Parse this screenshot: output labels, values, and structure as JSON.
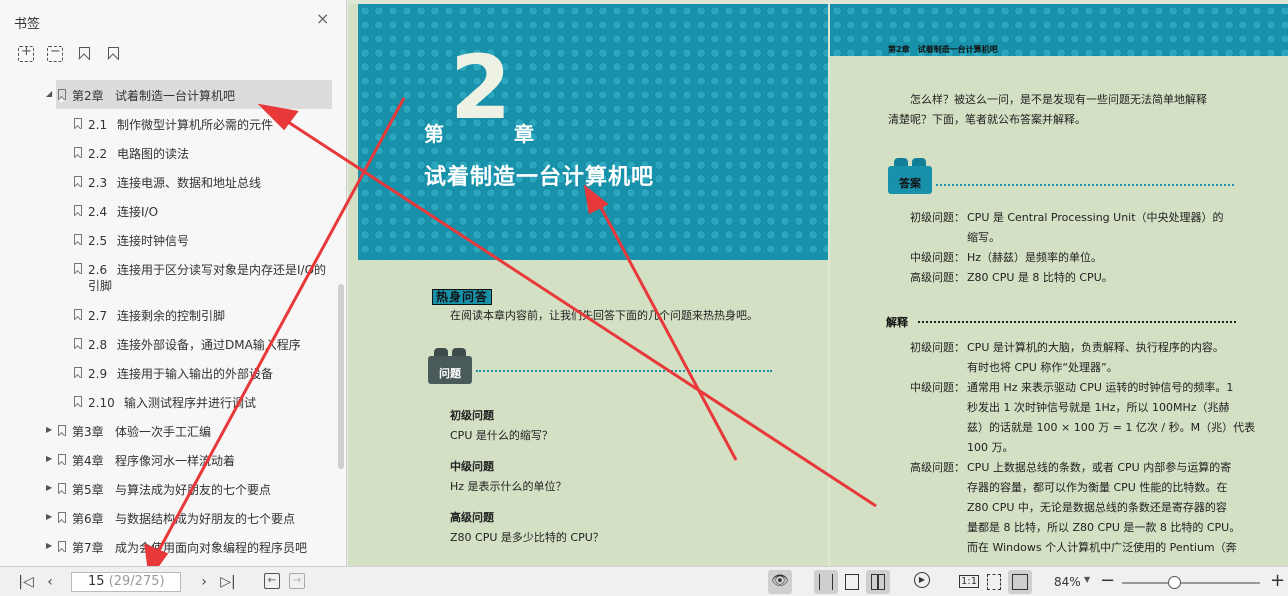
{
  "sidebar": {
    "title": "书签",
    "close": "×",
    "toc": [
      {
        "num": "第2章",
        "title": "试着制造一台计算机吧",
        "level": 0,
        "expanded": true,
        "selected": true
      },
      {
        "num": "2.1",
        "title": "制作微型计算机所必需的元件",
        "level": 1
      },
      {
        "num": "2.2",
        "title": "电路图的读法",
        "level": 1
      },
      {
        "num": "2.3",
        "title": "连接电源、数据和地址总线",
        "level": 1
      },
      {
        "num": "2.4",
        "title": "连接I/O",
        "level": 1
      },
      {
        "num": "2.5",
        "title": "连接时钟信号",
        "level": 1
      },
      {
        "num": "2.6",
        "title": "连接用于区分读写对象是内存还是I/O的引脚",
        "level": 1,
        "wrap": true
      },
      {
        "num": "2.7",
        "title": "连接剩余的控制引脚",
        "level": 1
      },
      {
        "num": "2.8",
        "title": "连接外部设备，通过DMA输入程序",
        "level": 1
      },
      {
        "num": "2.9",
        "title": "连接用于输入输出的外部设备",
        "level": 1
      },
      {
        "num": "2.10",
        "title": "输入测试程序并进行调试",
        "level": 1
      },
      {
        "num": "第3章",
        "title": "体验一次手工汇编",
        "level": 0
      },
      {
        "num": "第4章",
        "title": "程序像河水一样流动着",
        "level": 0
      },
      {
        "num": "第5章",
        "title": "与算法成为好朋友的七个要点",
        "level": 0
      },
      {
        "num": "第6章",
        "title": "与数据结构成为好朋友的七个要点",
        "level": 0
      },
      {
        "num": "第7章",
        "title": "成为会使用面向对象编程的程序员吧",
        "level": 0
      }
    ]
  },
  "left_page": {
    "chapter_prefix": "第",
    "chapter_number": "2",
    "chapter_suffix": "章",
    "chapter_title": "试着制造一台计算机吧",
    "warmup_label": "热身问答",
    "warmup_text": "在阅读本章内容前，让我们先回答下面的几个问题来热热身吧。",
    "question_label": "问题",
    "questions": [
      {
        "level": "初级问题",
        "text": "CPU 是什么的缩写？"
      },
      {
        "level": "中级问题",
        "text": "Hz 是表示什么的单位？"
      },
      {
        "level": "高级问题",
        "text": "Z80 CPU 是多少比特的 CPU？"
      }
    ]
  },
  "right_page": {
    "header": "第2章　试着制造一台计算机吧",
    "intro_line1": "怎么样？被这么一问，是不是发现有一些问题无法简单地解释",
    "intro_line2": "清楚呢？下面，笔者就公布答案并解释。",
    "answer_label": "答案",
    "answers": [
      {
        "level": "初级问题：",
        "line1": "CPU 是 Central Processing Unit（中央处理器）的",
        "line2": "缩写。"
      },
      {
        "level": "中级问题：",
        "line1": "Hz（赫兹）是频率的单位。"
      },
      {
        "level": "高级问题：",
        "line1": "Z80 CPU 是 8 比特的 CPU。"
      }
    ],
    "explain_label": "解释",
    "explanations": [
      {
        "level": "初级问题：",
        "lines": [
          "CPU 是计算机的大脑，负责解释、执行程序的内容。",
          "有时也将 CPU 称作“处理器”。"
        ]
      },
      {
        "level": "中级问题：",
        "lines": [
          "通常用 Hz 来表示驱动 CPU 运转的时钟信号的频率。1",
          "秒发出 1 次时钟信号就是 1Hz，所以 100MHz（兆赫",
          "兹）的话就是 100 × 100 万 = 1 亿次 / 秒。M（兆）代表",
          "100 万。"
        ]
      },
      {
        "level": "高级问题：",
        "lines": [
          "CPU 上数据总线的条数，或者 CPU 内部参与运算的寄",
          "存器的容量，都可以作为衡量 CPU 性能的比特数。在",
          "Z80 CPU 中，无论是数据总线的条数还是寄存器的容",
          "量都是 8 比特，所以 Z80 CPU 是一款 8 比特的 CPU。",
          "而在 Windows 个人计算机中广泛使用的 Pentium（奔"
        ]
      }
    ]
  },
  "status_bar": {
    "page_current": "15",
    "page_info": "(29/275)",
    "zoom": "84%",
    "zoom_level": 0.38,
    "fit_one": "1:1"
  },
  "colors": {
    "lego_teal": "#1892aa",
    "page_bg": "#d3e0c4",
    "brick_dark": "#4a5a5a",
    "annotation_red": "#e8383a"
  }
}
